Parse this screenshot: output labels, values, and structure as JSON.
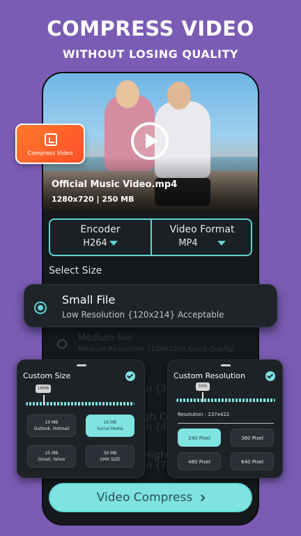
{
  "promo": {
    "headline": "COMPRESS VIDEO",
    "subheadline": "WITHOUT LOSING QUALITY"
  },
  "video": {
    "file_name": "Official Music Video.mp4",
    "meta": "1280x720 | 250 MB"
  },
  "badge": {
    "label": "Compress Video",
    "icon": "compress-icon"
  },
  "options": {
    "encoder_label": "Encoder",
    "encoder_value": "H264",
    "format_label": "Video Format",
    "format_value": "MP4"
  },
  "select_size_label": "Select Size",
  "sizes": [
    {
      "title": "Small File",
      "desc": "Low Resolution {120x214} Acceptable",
      "selected": true
    },
    {
      "title": "Medium File",
      "desc": "Medium Resolution {180x320} Good Quality",
      "selected": false
    }
  ],
  "faded_fragments": [
    "n {360",
    "gh Qu",
    "n {480",
    "High",
    "n {720"
  ],
  "custom_size": {
    "title": "Custom Size",
    "slider_value_label": "16MB",
    "slider_value": 0.16,
    "chips": [
      {
        "size": "10 MB",
        "label": "Outlook, Hotmail",
        "selected": false
      },
      {
        "size": "16 MB",
        "label": "Social Media",
        "selected": true
      },
      {
        "size": "25 MB",
        "label": "Gmail, Yahoo",
        "selected": false
      },
      {
        "size": "50 MB",
        "label": "GMX SIZE",
        "selected": false
      }
    ]
  },
  "custom_resolution": {
    "title": "Custom Resolution",
    "slider_value_label": "33%",
    "slider_value": 0.33,
    "resolution_text": "Resolution : 237x422",
    "chips": [
      {
        "label": "240 Pixel",
        "selected": true
      },
      {
        "label": "360 Pixel",
        "selected": false
      },
      {
        "label": "480 Pixel",
        "selected": false
      },
      {
        "label": "640 Pixel",
        "selected": false
      }
    ]
  },
  "cta_label": "Video Compress",
  "colors": {
    "background": "#7a5cb4",
    "accent": "#7fe3e0",
    "badge": "#ff6a2a",
    "panel": "#1d2226"
  }
}
